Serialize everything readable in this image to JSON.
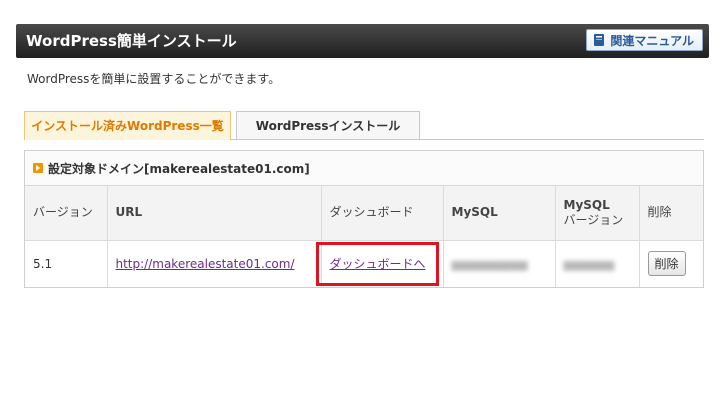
{
  "header": {
    "title": "WordPress簡単インストール",
    "manual_label": "関連マニュアル",
    "manual_icon": "book-icon"
  },
  "intro_text": "WordPressを簡単に設置することができます。",
  "tabs": [
    {
      "label": "インストール済みWordPress一覧",
      "active": true
    },
    {
      "label": "WordPressインストール",
      "active": false
    }
  ],
  "panel": {
    "heading": "設定対象ドメイン[makerealestate01.com]",
    "columns": {
      "version": "バージョン",
      "url": "URL",
      "dashboard": "ダッシュボード",
      "mysql": "MySQL",
      "mysql_version_1": "MySQL",
      "mysql_version_2": "バージョン",
      "delete": "削除"
    },
    "rows": [
      {
        "version": "5.1",
        "url": "http://makerealestate01.com/",
        "dashboard_link": "ダッシュボードへ",
        "mysql": "",
        "mysql_version": "",
        "delete_label": "削除"
      }
    ]
  },
  "colors": {
    "highlight": "#e0141e",
    "active_tab_text": "#e07a00",
    "link": "#6a2c91"
  }
}
